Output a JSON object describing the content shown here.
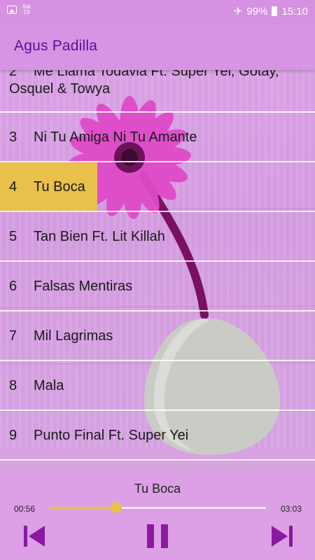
{
  "status_bar": {
    "date_day": "Sat",
    "date_num": "19",
    "battery": "99%",
    "time": "15:10"
  },
  "app": {
    "title": "Agus Padilla"
  },
  "tracks": [
    {
      "num": "2",
      "line1": "Me Llama Todavia Ft. Super Yei, Gotay,",
      "line2": "Osquel & Towya"
    },
    {
      "num": "3",
      "name": "Ni Tu Amiga Ni Tu Amante"
    },
    {
      "num": "4",
      "name": "Tu Boca",
      "selected": true
    },
    {
      "num": "5",
      "name": "Tan Bien Ft. Lit Killah"
    },
    {
      "num": "6",
      "name": "Falsas Mentiras"
    },
    {
      "num": "7",
      "name": "Mil Lagrimas"
    },
    {
      "num": "8",
      "name": "Mala"
    },
    {
      "num": "9",
      "name": "Punto Final Ft. Super Yei"
    }
  ],
  "player": {
    "now_playing": "Tu Boca",
    "current_time": "00:56",
    "duration": "03:03",
    "progress": 0.31
  },
  "colors": {
    "accent": "#e8c04a",
    "title": "#5a0f8f",
    "controls": "#8a1aa0"
  },
  "icons": {
    "prev": "skip-previous-icon",
    "pause": "pause-icon",
    "next": "skip-next-icon"
  }
}
